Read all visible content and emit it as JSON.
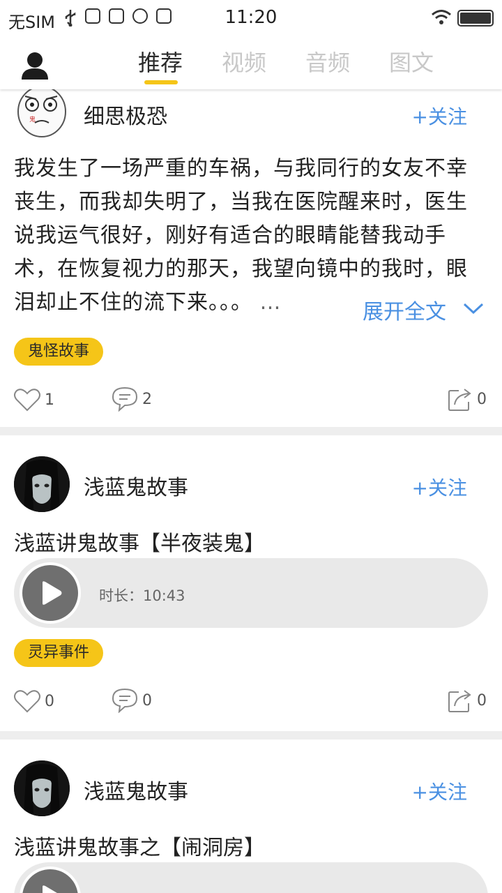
{
  "status_bar": {
    "carrier": "无SIM",
    "time": "11:20"
  },
  "nav": {
    "tabs": [
      {
        "label": "推荐",
        "active": true
      },
      {
        "label": "视频",
        "active": false
      },
      {
        "label": "音频",
        "active": false
      },
      {
        "label": "图文",
        "active": false
      }
    ],
    "accent_color": "#f5c518"
  },
  "posts": [
    {
      "author": "细思极恐",
      "follow_label": "+关注",
      "avatar_icon": "rage-face-avatar",
      "text_lines": [
        "我发生了一场严重的车祸，与我同行的女友不幸",
        "丧生，而我却失明了，当我在医院醒来时，医生",
        "说我运气很好，刚好有适合的眼睛能替我动手",
        "术，在恢复视力的那天，我望向镜中的我时，眼",
        "泪却止不住的流下来。。。"
      ],
      "ellipsis": "…",
      "expand_label": "展开全文",
      "tag": "鬼怪故事",
      "likes": "1",
      "comments": "2",
      "shares": "0"
    },
    {
      "author": "浅蓝鬼故事",
      "follow_label": "+关注",
      "avatar_icon": "ghost-avatar",
      "title": "浅蓝讲鬼故事【半夜装鬼】",
      "duration": "时长：10:43",
      "tag": "灵异事件",
      "likes": "0",
      "comments": "0",
      "shares": "0"
    },
    {
      "author": "浅蓝鬼故事",
      "follow_label": "+关注",
      "avatar_icon": "ghost-avatar",
      "title": "浅蓝讲鬼故事之【闹洞房】"
    }
  ],
  "colors": {
    "link_blue": "#4a90e2",
    "tag_yellow": "#f5c518"
  }
}
